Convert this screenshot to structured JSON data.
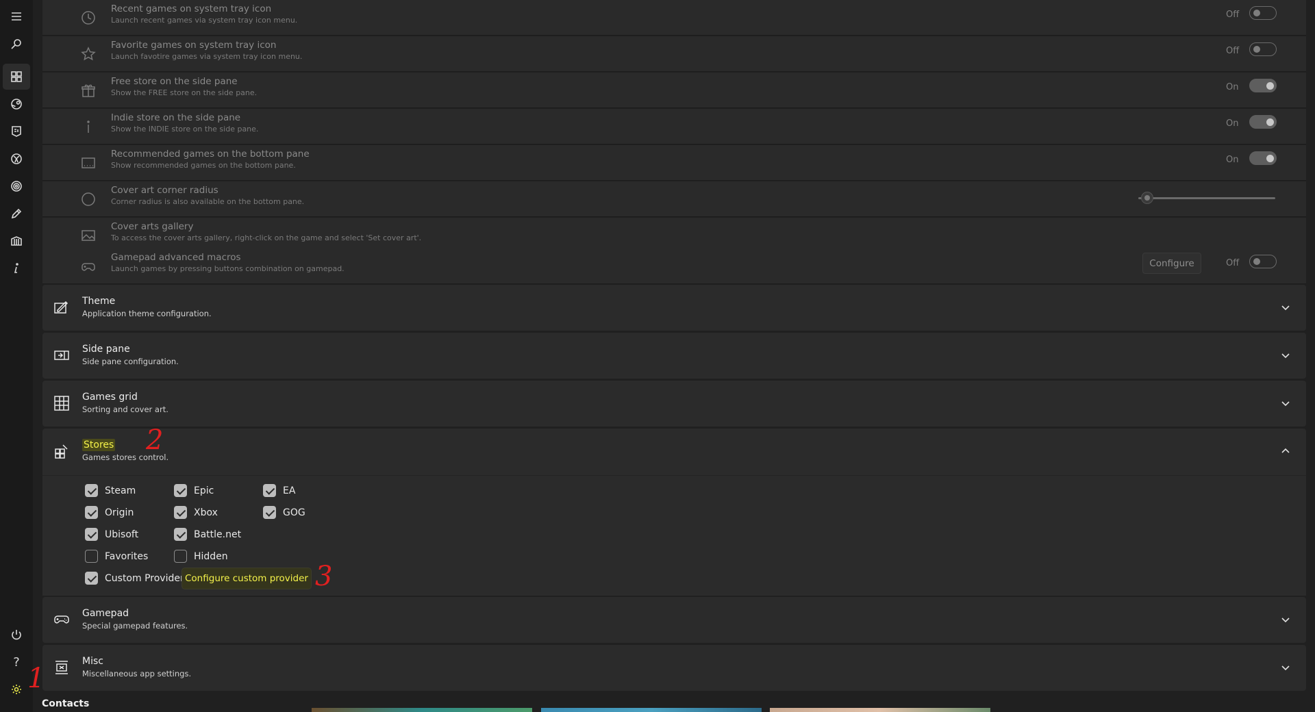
{
  "nav": {
    "items": [
      "menu-icon",
      "search-icon",
      "library-icon",
      "steam-icon",
      "epic-icon",
      "xbox-icon",
      "ubisoft-icon",
      "edit-icon",
      "store-icon",
      "info-icon"
    ],
    "bottom": [
      "power-icon",
      "help-icon",
      "settings-icon"
    ],
    "help_label": "?"
  },
  "dim_rows": [
    {
      "title": "Recent games on system tray icon",
      "subtitle": "Launch recent games via system tray icon menu.",
      "icon": "clock-icon",
      "toggle": "Off"
    },
    {
      "title": "Favorite games on system tray icon",
      "subtitle": "Launch favotire games via system tray icon menu.",
      "icon": "star-icon",
      "toggle": "Off"
    },
    {
      "title": "Free store on the side pane",
      "subtitle": "Show the FREE store on the side pane.",
      "icon": "gift-icon",
      "toggle": "On"
    },
    {
      "title": "Indie store on the side pane",
      "subtitle": "Show the INDIE store on the side pane.",
      "icon": "info-icon",
      "toggle": "On"
    },
    {
      "title": "Recommended games on the bottom pane",
      "subtitle": "Show recommended games on the bottom pane.",
      "icon": "bottom-pane-icon",
      "toggle": "On"
    },
    {
      "title": "Cover art corner radius",
      "subtitle": "Corner radius is also available on the bottom pane.",
      "icon": "circle-icon",
      "slider_value": 0.05
    },
    {
      "title": "Cover arts gallery",
      "subtitle": "To access the cover arts gallery, right-click on the game and select 'Set cover art'.",
      "icon": "image-icon"
    },
    {
      "title": "Gamepad advanced macros",
      "subtitle": "Launch games by pressing buttons combination on gamepad.",
      "icon": "gamepad-icon",
      "button": "Configure",
      "toggle": "Off"
    }
  ],
  "sections": {
    "theme": {
      "title": "Theme",
      "subtitle": "Application theme configuration."
    },
    "side_pane": {
      "title": "Side pane",
      "subtitle": "Side pane configuration."
    },
    "games_grid": {
      "title": "Games grid",
      "subtitle": "Sorting and cover art."
    },
    "stores": {
      "title": "Stores",
      "subtitle": "Games stores control."
    },
    "gamepad": {
      "title": "Gamepad",
      "subtitle": "Special gamepad features."
    },
    "misc": {
      "title": "Misc",
      "subtitle": "Miscellaneous app settings."
    }
  },
  "stores": {
    "items": [
      {
        "label": "Steam",
        "checked": true
      },
      {
        "label": "Epic",
        "checked": true
      },
      {
        "label": "EA",
        "checked": true
      },
      {
        "label": "Origin",
        "checked": true
      },
      {
        "label": "Xbox",
        "checked": true
      },
      {
        "label": "GOG",
        "checked": true
      },
      {
        "label": "Ubisoft",
        "checked": true
      },
      {
        "label": "Battle.net",
        "checked": true
      },
      {
        "label": "Favorites",
        "checked": false
      },
      {
        "label": "Hidden",
        "checked": false
      },
      {
        "label": "Custom Provider",
        "checked": true
      }
    ],
    "configure_button": "Configure custom provider"
  },
  "annotations": [
    "1",
    "2",
    "3"
  ],
  "footer": {
    "contacts": "Contacts"
  },
  "colors": {
    "highlight_text": "#f4f24a",
    "annotation": "#e02020"
  }
}
